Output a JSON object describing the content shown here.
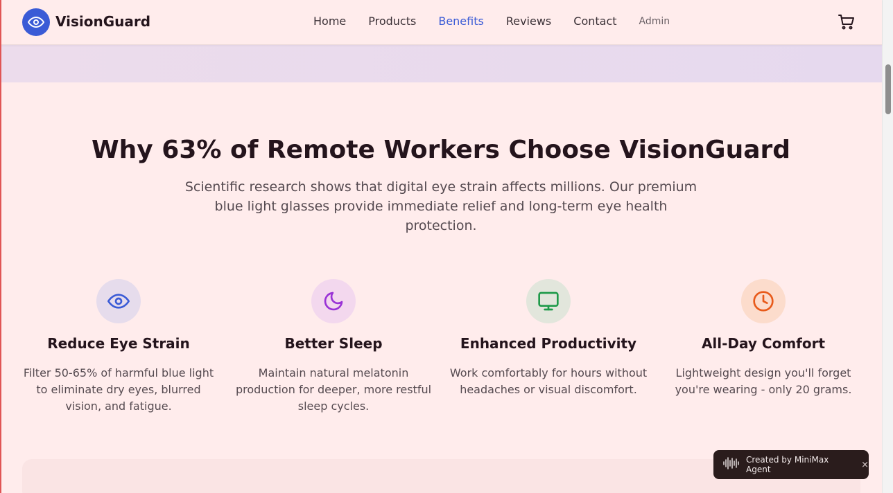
{
  "header": {
    "brand": "VisionGuard",
    "nav": [
      {
        "label": "Home"
      },
      {
        "label": "Products"
      },
      {
        "label": "Benefits",
        "active": true
      },
      {
        "label": "Reviews"
      },
      {
        "label": "Contact"
      }
    ],
    "admin_label": "Admin",
    "cart_icon": "cart-icon",
    "logo_icon": "eye-icon"
  },
  "benefits": {
    "title": "Why 63% of Remote Workers Choose VisionGuard",
    "subtitle": "Scientific research shows that digital eye strain affects millions. Our premium blue light glasses provide immediate relief and long-term eye health protection.",
    "features": [
      {
        "icon": "eye-icon",
        "title": "Reduce Eye Strain",
        "desc": "Filter 50-65% of harmful blue light to eliminate dry eyes, blurred vision, and fatigue.",
        "color": "#3a5bd6",
        "bg": "#e6dcec"
      },
      {
        "icon": "moon-icon",
        "title": "Better Sleep",
        "desc": "Maintain natural melatonin production for deeper, more restful sleep cycles.",
        "color": "#9a33d6",
        "bg": "#f3d8ee"
      },
      {
        "icon": "monitor-icon",
        "title": "Enhanced Productivity",
        "desc": "Work comfortably for hours without headaches or visual discomfort.",
        "color": "#1f9a4a",
        "bg": "#e2e6dc"
      },
      {
        "icon": "clock-icon",
        "title": "All-Day Comfort",
        "desc": "Lightweight design you'll forget you're wearing - only 20 grams.",
        "color": "#e85a1a",
        "bg": "#fcdccc"
      }
    ]
  },
  "badge": {
    "label": "Created by MiniMax Agent",
    "close": "×"
  },
  "colors": {
    "accent": "#3a5bd6",
    "background": "#ffecec",
    "text": "#24141c"
  }
}
